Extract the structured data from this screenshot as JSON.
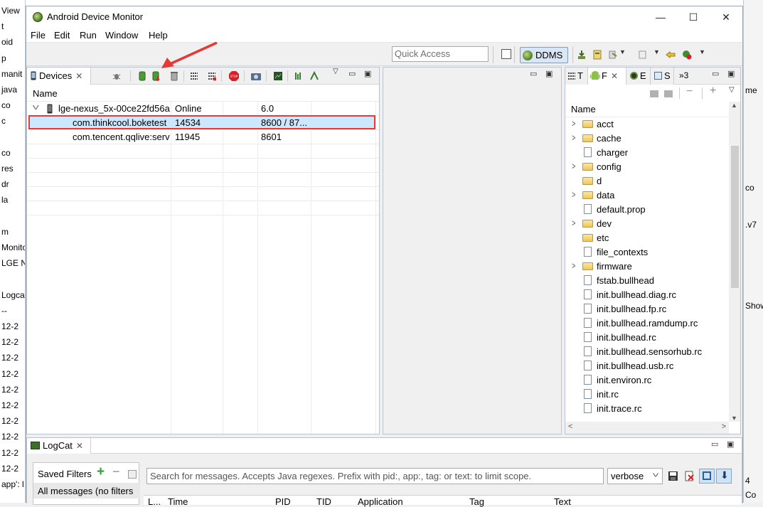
{
  "bg_left_rows": [
    "View",
    "t",
    "oid",
    "p",
    "manit",
    "java",
    "co",
    "c",
    "",
    "co",
    "res",
    "dr",
    "la",
    "",
    "m",
    "Monito",
    "LGE Ne",
    "",
    "Logcat",
    "--",
    "12-2",
    "12-2",
    "12-2",
    "12-2",
    "12-2",
    "12-2",
    "12-2",
    "12-2",
    "12-2",
    "12-2",
    "app': l"
  ],
  "bg_right_rows": [
    "me",
    "co",
    ".v7",
    "Show",
    "4",
    "Co"
  ],
  "window": {
    "title": "Android Device Monitor",
    "minimize": "—",
    "maximize": "☐",
    "close": "✕"
  },
  "menu": [
    "File",
    "Edit",
    "Run",
    "Window",
    "Help"
  ],
  "toolbar": {
    "quick_access_placeholder": "Quick Access",
    "perspective_label": "DDMS"
  },
  "devices_view": {
    "tab_label": "Devices",
    "column_header": "Name",
    "device": {
      "name": "lge-nexus_5x-00ce22fd56a3",
      "status": "Online",
      "version": "6.0"
    },
    "processes": [
      {
        "name": "com.thinkcool.boketest",
        "pid": "14534",
        "port": "8600 / 87...",
        "selected": true
      },
      {
        "name": "com.tencent.qqlive:servi",
        "pid": "11945",
        "port": "8601",
        "selected": false
      }
    ]
  },
  "file_explorer": {
    "tabs": [
      "T",
      "F",
      "E",
      "S",
      "»3"
    ],
    "column_header": "Name",
    "items": [
      {
        "name": "acct",
        "type": "folder",
        "expandable": true
      },
      {
        "name": "cache",
        "type": "folder",
        "expandable": true
      },
      {
        "name": "charger",
        "type": "file",
        "expandable": false
      },
      {
        "name": "config",
        "type": "folder",
        "expandable": true
      },
      {
        "name": "d",
        "type": "folder",
        "expandable": false
      },
      {
        "name": "data",
        "type": "folder",
        "expandable": true
      },
      {
        "name": "default.prop",
        "type": "file",
        "expandable": false
      },
      {
        "name": "dev",
        "type": "folder",
        "expandable": true
      },
      {
        "name": "etc",
        "type": "folder",
        "expandable": false
      },
      {
        "name": "file_contexts",
        "type": "file",
        "expandable": false
      },
      {
        "name": "firmware",
        "type": "folder",
        "expandable": true
      },
      {
        "name": "fstab.bullhead",
        "type": "file",
        "expandable": false
      },
      {
        "name": "init.bullhead.diag.rc",
        "type": "file",
        "expandable": false
      },
      {
        "name": "init.bullhead.fp.rc",
        "type": "file",
        "expandable": false
      },
      {
        "name": "init.bullhead.ramdump.rc",
        "type": "file",
        "expandable": false
      },
      {
        "name": "init.bullhead.rc",
        "type": "file",
        "expandable": false
      },
      {
        "name": "init.bullhead.sensorhub.rc",
        "type": "file",
        "expandable": false
      },
      {
        "name": "init.bullhead.usb.rc",
        "type": "file",
        "expandable": false
      },
      {
        "name": "init.environ.rc",
        "type": "file",
        "expandable": false
      },
      {
        "name": "init.rc",
        "type": "file",
        "expandable": false
      },
      {
        "name": "init.trace.rc",
        "type": "file",
        "expandable": false
      }
    ]
  },
  "logcat": {
    "tab_label": "LogCat",
    "saved_filters_label": "Saved Filters",
    "all_messages_label": "All messages (no filters",
    "search_placeholder": "Search for messages. Accepts Java regexes. Prefix with pid:, app:, tag: or text: to limit scope.",
    "level": "verbose",
    "columns": [
      "L...",
      "Time",
      "PID",
      "TID",
      "Application",
      "Tag",
      "Text"
    ]
  },
  "colors": {
    "selection": "#cce8ff",
    "annotation_red": "#e53935",
    "ddms_active": "#dce6f2"
  }
}
